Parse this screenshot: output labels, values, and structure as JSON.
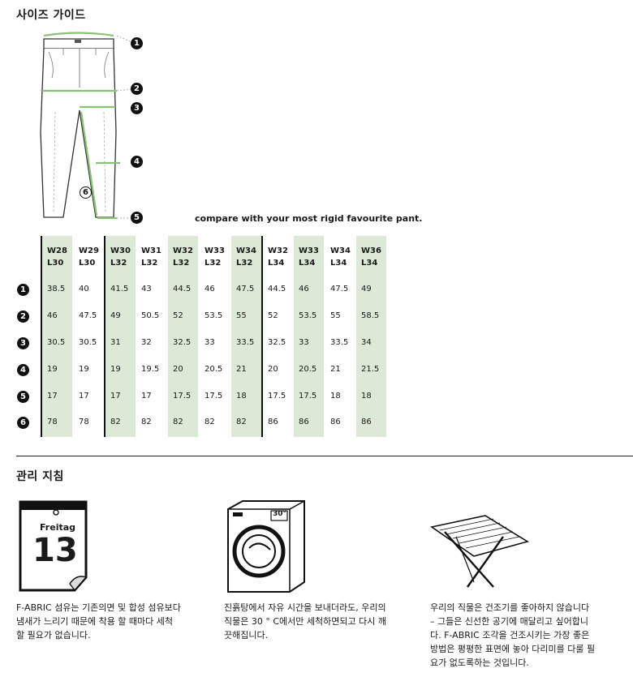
{
  "size_guide": {
    "title": "사이즈 가이드",
    "compare_note": "compare with your most rigid favourite pant.",
    "marker_labels": [
      "1",
      "2",
      "3",
      "4",
      "5",
      "6"
    ],
    "columns": [
      {
        "w": "W28",
        "l": "L30",
        "shaded": true
      },
      {
        "w": "W29",
        "l": "L30",
        "shaded": false
      },
      {
        "w": "W30",
        "l": "L32",
        "shaded": true
      },
      {
        "w": "W31",
        "l": "L32",
        "shaded": false
      },
      {
        "w": "W32",
        "l": "L32",
        "shaded": true
      },
      {
        "w": "W33",
        "l": "L32",
        "shaded": false
      },
      {
        "w": "W34",
        "l": "L32",
        "shaded": true
      },
      {
        "w": "W32",
        "l": "L34",
        "shaded": false
      },
      {
        "w": "W33",
        "l": "L34",
        "shaded": true
      },
      {
        "w": "W34",
        "l": "L34",
        "shaded": false
      },
      {
        "w": "W36",
        "l": "L34",
        "shaded": true
      }
    ],
    "rows": [
      {
        "label": "1",
        "values": [
          "38.5",
          "40",
          "41.5",
          "43",
          "44.5",
          "46",
          "47.5",
          "44.5",
          "46",
          "47.5",
          "49"
        ]
      },
      {
        "label": "2",
        "values": [
          "46",
          "47.5",
          "49",
          "50.5",
          "52",
          "53.5",
          "55",
          "52",
          "53.5",
          "55",
          "58.5"
        ]
      },
      {
        "label": "3",
        "values": [
          "30.5",
          "30.5",
          "31",
          "32",
          "32.5",
          "33",
          "33.5",
          "32.5",
          "33",
          "33.5",
          "34"
        ]
      },
      {
        "label": "4",
        "values": [
          "19",
          "19",
          "19",
          "19.5",
          "20",
          "20.5",
          "21",
          "20",
          "20.5",
          "21",
          "21.5"
        ]
      },
      {
        "label": "5",
        "values": [
          "17",
          "17",
          "17",
          "17",
          "17.5",
          "17.5",
          "18",
          "17.5",
          "17.5",
          "18",
          "18"
        ]
      },
      {
        "label": "6",
        "values": [
          "78",
          "78",
          "82",
          "82",
          "82",
          "82",
          "82",
          "86",
          "86",
          "86",
          "86"
        ]
      }
    ]
  },
  "care": {
    "title": "관리 지침",
    "calendar": {
      "day_name": "Freitag",
      "day_number": "13"
    },
    "washer_temp": "30°",
    "items": [
      {
        "lines": [
          "F-ABRIC 섬유는 기존의면 및 합성 섬유보다",
          "냄새가 느리기 때문에 착용 할 때마다 세척",
          "할 필요가 없습니다."
        ]
      },
      {
        "lines": [
          "진흙탕에서 자유 시간을 보내더라도, 우리의",
          "직물은 30 ° C에서만 세척하면되고 다시 깨",
          "끗해집니다."
        ]
      },
      {
        "lines": [
          "우리의 직물은 건조기를 좋아하지 않습니다",
          "– 그들은 신선한 공기에 매달리고 싶어합니",
          "다. F-ABRIC 조각을 건조시키는 가장 좋은",
          "방법은 평평한 표면에 놓아 다리미를 다룰 필",
          "요가 없도록하는 것입니다."
        ]
      }
    ]
  },
  "colors": {
    "accent_green": "#dbe9d6",
    "measure_green": "#8cc17a",
    "ink": "#111111"
  }
}
